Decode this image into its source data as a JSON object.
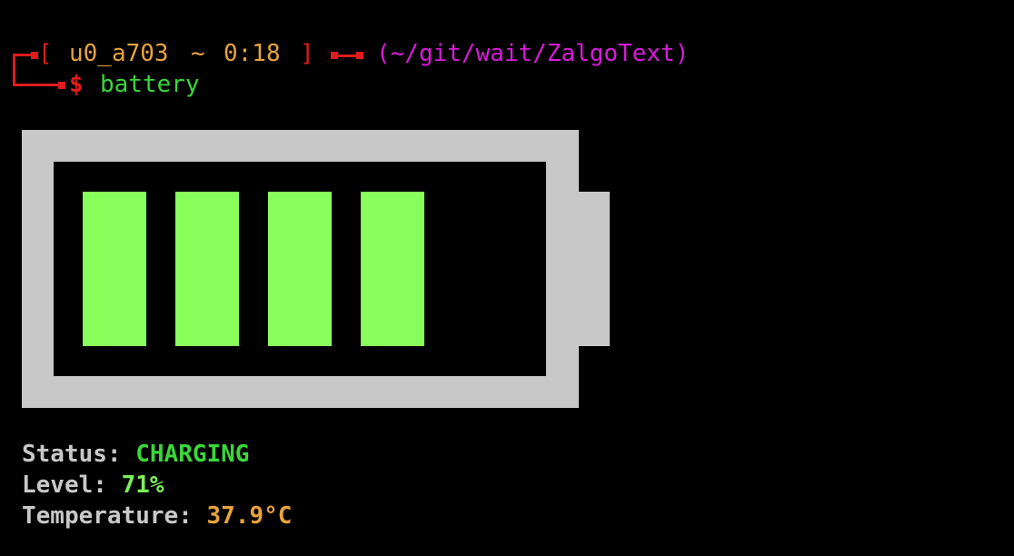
{
  "prompt": {
    "open_bracket": "[",
    "user": "u0_a703",
    "tilde": "~",
    "time": "0:18",
    "close_bracket": "]",
    "path": "(~/git/wait/ZalgoText)",
    "symbol": "$",
    "command": "battery"
  },
  "battery": {
    "level_fraction": 0.71,
    "filled_cells": 4,
    "total_cells": 5,
    "frame_color": "#c8c8c8",
    "cell_color": "#88ff5a"
  },
  "info": {
    "status_label": "Status:",
    "status_value": "CHARGING",
    "level_label": "Level:",
    "level_value": "71%",
    "temp_label": "Temperature:",
    "temp_value": "37.9°C"
  },
  "colors": {
    "background": "#000000",
    "prompt_red": "#e01b1b",
    "prompt_orange": "#e8a33d",
    "prompt_magenta": "#d91ad9",
    "prompt_green": "#3ad63a"
  }
}
